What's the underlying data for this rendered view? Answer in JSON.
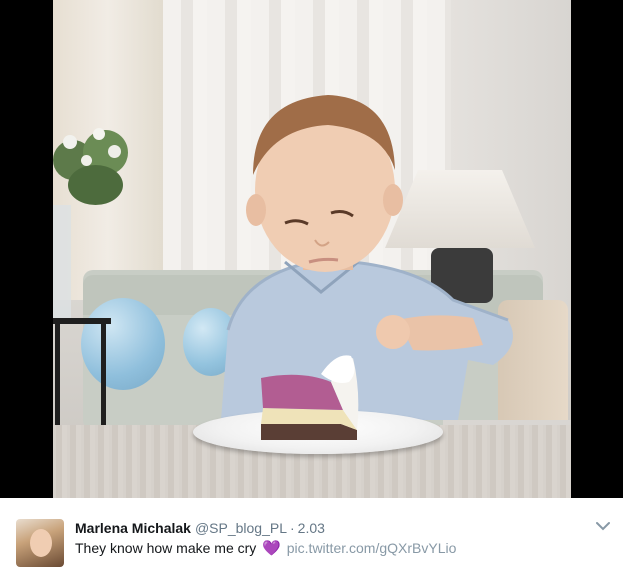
{
  "tweet": {
    "display_name": "Marlena Michalak",
    "handle": "@SP_blog_PL",
    "separator": "·",
    "time": "2.03",
    "text": "They know how make me cry",
    "emoji": "💜",
    "link": "pic.twitter.com/gQXrBvYLio"
  },
  "colors": {
    "name_text": "#14171a",
    "meta_text": "#657786",
    "link_text": "#8899a6",
    "emoji": "#9b59b6",
    "frame": "#000000"
  },
  "icons": {
    "avatar": "profile-photo",
    "caret": "chevron-down-icon",
    "emoji": "purple-heart-icon"
  }
}
